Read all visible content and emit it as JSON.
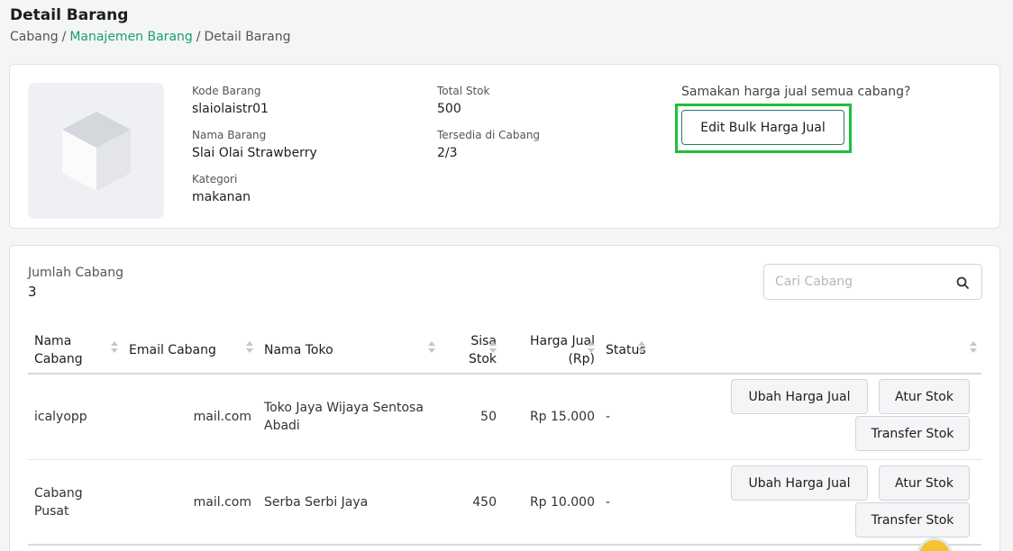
{
  "page": {
    "title": "Detail Barang"
  },
  "breadcrumb": {
    "item1": "Cabang",
    "item2": "Manajemen Barang",
    "item3": "Detail Barang",
    "separator": "/"
  },
  "product": {
    "icon": "box-placeholder-icon",
    "kode_label": "Kode Barang",
    "kode_value": "slaiolaistr01",
    "nama_label": "Nama Barang",
    "nama_value": "Slai Olai Strawberry",
    "kategori_label": "Kategori",
    "kategori_value": "makanan",
    "stok_label": "Total Stok",
    "stok_value": "500",
    "tersedia_label": "Tersedia di Cabang",
    "tersedia_value": "2/3"
  },
  "bulk": {
    "question": "Samakan harga jual semua cabang?",
    "button_label": "Edit Bulk Harga Jual",
    "highlight_color": "#1fbf3c"
  },
  "branches": {
    "count_label": "Jumlah Cabang",
    "count_value": "3",
    "search_placeholder": "Cari Cabang",
    "search_icon": "search-icon",
    "columns": {
      "nama_line1": "Nama",
      "nama_line2": "Cabang",
      "email": "Email Cabang",
      "toko": "Nama Toko",
      "sisa_line1": "Sisa",
      "sisa_line2": "Stok",
      "harga_line1": "Harga Jual",
      "harga_line2": "(Rp)",
      "status": "Status"
    },
    "rows": [
      {
        "nama_line1": "icalyopp",
        "nama_line2": "",
        "email": "mail.com",
        "toko_line1": "Toko Jaya Wijaya Sentosa",
        "toko_line2": "Abadi",
        "sisa": "50",
        "harga": "Rp 15.000",
        "status": "-"
      },
      {
        "nama_line1": "Cabang",
        "nama_line2": "Pusat",
        "email": "mail.com",
        "toko_line1": "Serba Serbi Jaya",
        "toko_line2": "",
        "sisa": "450",
        "harga": "Rp 10.000",
        "status": "-"
      }
    ],
    "actions": {
      "ubah": "Ubah Harga Jual",
      "atur": "Atur Stok",
      "transfer": "Transfer Stok"
    }
  },
  "colors": {
    "accent": "#1ba06b",
    "button_border": "#2f7a6b"
  }
}
